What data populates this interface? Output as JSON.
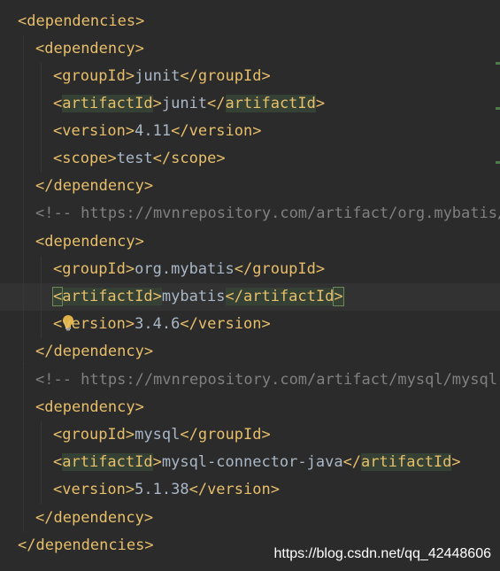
{
  "lines": [
    {
      "open": "<",
      "tag": "dependencies",
      "close": ">"
    },
    {
      "open": "<",
      "tag": "dependency",
      "close": ">"
    },
    {
      "open1": "<",
      "tag1": "groupId",
      "close1": ">",
      "text": "junit",
      "open2": "</",
      "tag2": "groupId",
      "close2": ">"
    },
    {
      "open1": "<",
      "tag1": "artifactId",
      "close1": ">",
      "text": "junit",
      "open2": "</",
      "tag2": "artifactId",
      "close2": ">"
    },
    {
      "open1": "<",
      "tag1": "version",
      "close1": ">",
      "text": "4.11",
      "open2": "</",
      "tag2": "version",
      "close2": ">"
    },
    {
      "open1": "<",
      "tag1": "scope",
      "close1": ">",
      "text": "test",
      "open2": "</",
      "tag2": "scope",
      "close2": ">"
    },
    {
      "open": "</",
      "tag": "dependency",
      "close": ">"
    },
    {
      "comment": "<!-- https://mvnrepository.com/artifact/org.mybatis/m"
    },
    {
      "open": "<",
      "tag": "dependency",
      "close": ">"
    },
    {
      "open1": "<",
      "tag1": "groupId",
      "close1": ">",
      "text": "org.mybatis",
      "open2": "</",
      "tag2": "groupId",
      "close2": ">"
    },
    {
      "open1": "<",
      "tag1": "artifactId",
      "close1": ">",
      "text": "mybatis",
      "open2": "</",
      "tag2": "artifactId",
      "close2": ">"
    },
    {
      "open1": "<",
      "tag1": "version",
      "close1": ">",
      "text": "3.4.6",
      "open2": "</",
      "tag2": "version",
      "close2": ">"
    },
    {
      "open": "</",
      "tag": "dependency",
      "close": ">"
    },
    {
      "comment": "<!-- https://mvnrepository.com/artifact/mysql/mysql-c"
    },
    {
      "open": "<",
      "tag": "dependency",
      "close": ">"
    },
    {
      "open1": "<",
      "tag1": "groupId",
      "close1": ">",
      "text": "mysql",
      "open2": "</",
      "tag2": "groupId",
      "close2": ">"
    },
    {
      "open1": "<",
      "tag1": "artifactId",
      "close1": ">",
      "text": "mysql-connector-java",
      "open2": "</",
      "tag2": "artifactId",
      "close2": ">"
    },
    {
      "open1": "<",
      "tag1": "version",
      "close1": ">",
      "text": "5.1.38",
      "open2": "</",
      "tag2": "version",
      "close2": ">"
    },
    {
      "open": "</",
      "tag": "dependency",
      "close": ">"
    },
    {
      "open": "</",
      "tag": "dependencies",
      "close": ">"
    }
  ],
  "watermark": "https://blog.csdn.net/qq_42448606",
  "icons": {
    "intention": "lightbulb-icon"
  },
  "colors": {
    "background": "#2b2b2b",
    "tag": "#e8bf6a",
    "text": "#a9b7c6",
    "comment": "#808080",
    "highlight": "#344134",
    "current_line": "#323232"
  }
}
